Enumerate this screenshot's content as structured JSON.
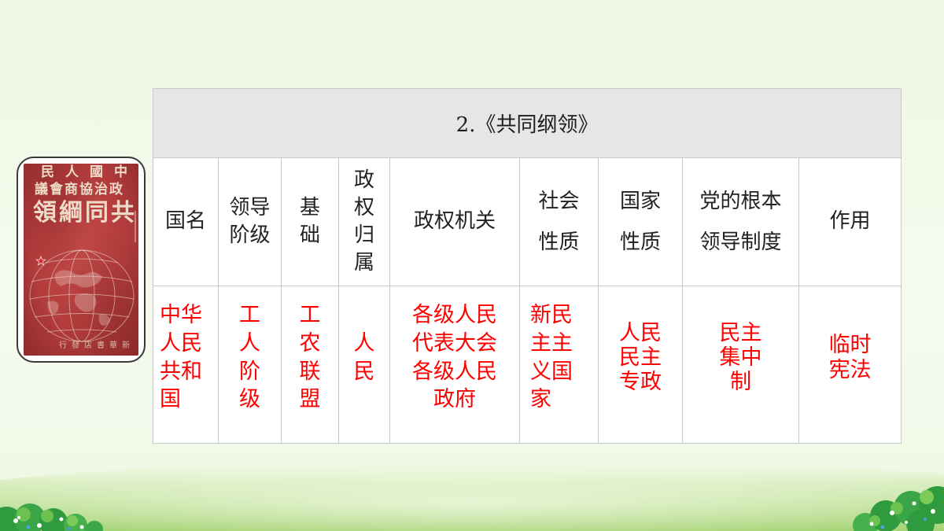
{
  "slide_title": "2.《共同纲领》",
  "cover": {
    "lines": [
      "中國人民",
      "政治協商會議",
      "共同綱領"
    ],
    "publisher": "新華書店發行"
  },
  "table": {
    "columns": [
      {
        "header": "国名",
        "value": "中华人民共和国"
      },
      {
        "header": "领导阶级",
        "value": "工人阶级"
      },
      {
        "header": "基础",
        "value": "工农联盟"
      },
      {
        "header": "政权归属",
        "value": "人民"
      },
      {
        "header": "政权机关",
        "value": "各级人民代表大会各级人民政府"
      },
      {
        "header": "社会性质",
        "value": "新民主主义国家"
      },
      {
        "header": "国家性质",
        "value": "人民民主专政"
      },
      {
        "header": "党的根本领导制度",
        "value": "民主集中制"
      },
      {
        "header": "作用",
        "value": "临时宪法"
      }
    ]
  },
  "colors": {
    "value_text": "#ff0000",
    "title_row_bg": "#e6e6e6",
    "cover_red": "#b33d3c",
    "meadow_green": "#9fd16a"
  }
}
